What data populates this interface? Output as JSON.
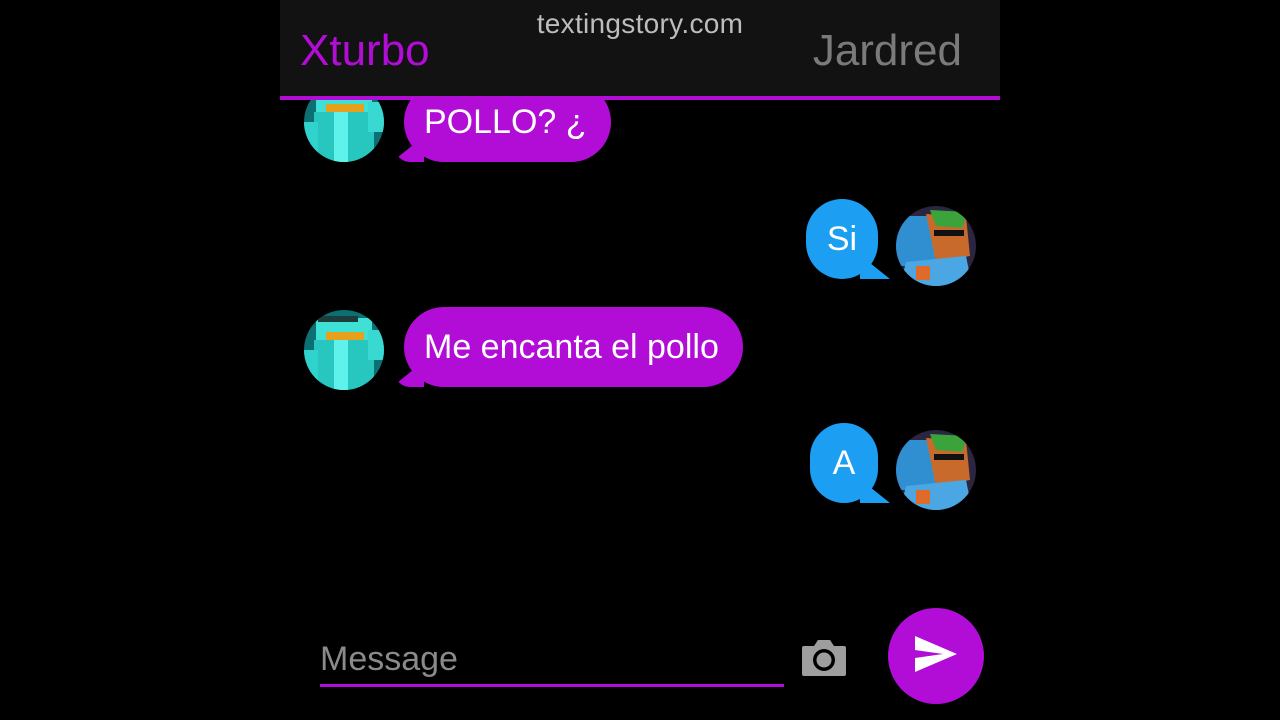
{
  "header": {
    "watermark": "textingstory.com",
    "left_contact": "Xturbo",
    "right_contact": "Jardred"
  },
  "messages": [
    {
      "side": "left",
      "sender": "Xturbo",
      "text": "POLLO? ¿"
    },
    {
      "side": "right",
      "sender": "Jardred",
      "text": "Si"
    },
    {
      "side": "left",
      "sender": "Xturbo",
      "text": "Me encanta el pollo"
    },
    {
      "side": "right",
      "sender": "Jardred",
      "text": "A"
    }
  ],
  "composer": {
    "placeholder": "Message",
    "camera_icon": "camera-icon",
    "send_icon": "send-icon"
  },
  "colors": {
    "accent_purple": "#b10dd6",
    "bubble_blue": "#1c9ef2",
    "background": "#000000",
    "header_bg": "#121212"
  }
}
